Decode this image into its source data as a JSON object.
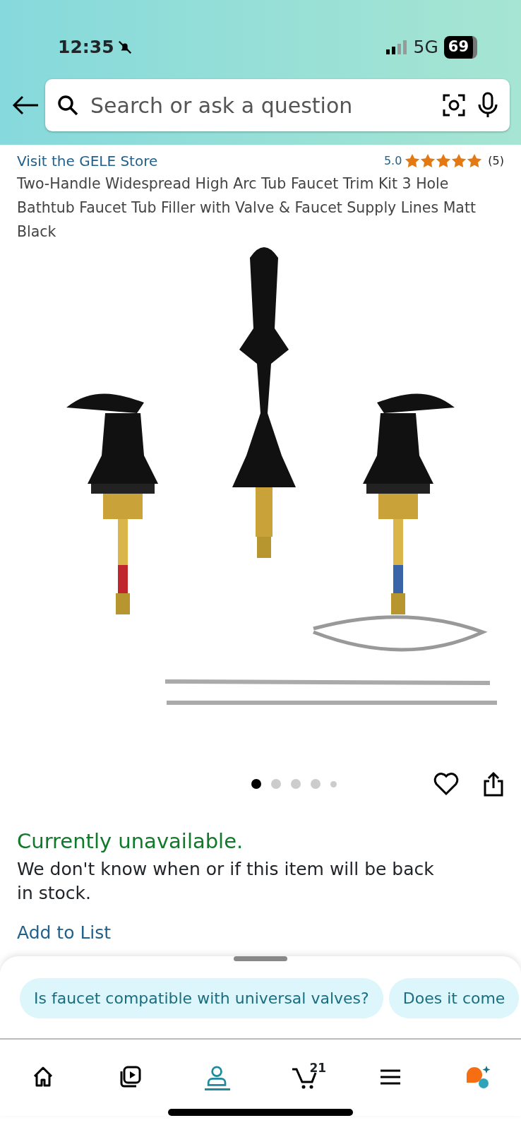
{
  "status_bar": {
    "time": "12:35",
    "network": "5G",
    "battery": "69",
    "muted": true
  },
  "search": {
    "placeholder": "Search or ask a question"
  },
  "product": {
    "store_link": "Visit the GELE Store",
    "rating": "5.0",
    "stars": 5,
    "review_count": "(5)",
    "title": "Two-Handle Widespread High Arc Tub Faucet Trim Kit 3 Hole Bathtub Faucet Tub Filler with Valve & Faucet Supply Lines Matt Black"
  },
  "gallery": {
    "dots": [
      {
        "selected": true
      },
      {
        "selected": false
      },
      {
        "selected": false
      },
      {
        "selected": false
      },
      {
        "selected": false
      }
    ],
    "favorite": false
  },
  "availability": {
    "status": "Currently unavailable.",
    "message": "We don't know when or if this item will be back in stock.",
    "add_to_list": "Add to List"
  },
  "suggestions": [
    {
      "text": "Is faucet compatible with universal valves?"
    },
    {
      "text": "Does it come"
    }
  ],
  "nav": [
    {
      "kind": "home",
      "selected": false
    },
    {
      "kind": "video",
      "selected": false
    },
    {
      "kind": "profile",
      "selected": true
    },
    {
      "kind": "cart",
      "selected": false,
      "badge": "21"
    },
    {
      "kind": "menu",
      "selected": false
    },
    {
      "kind": "assistant",
      "selected": false
    }
  ]
}
